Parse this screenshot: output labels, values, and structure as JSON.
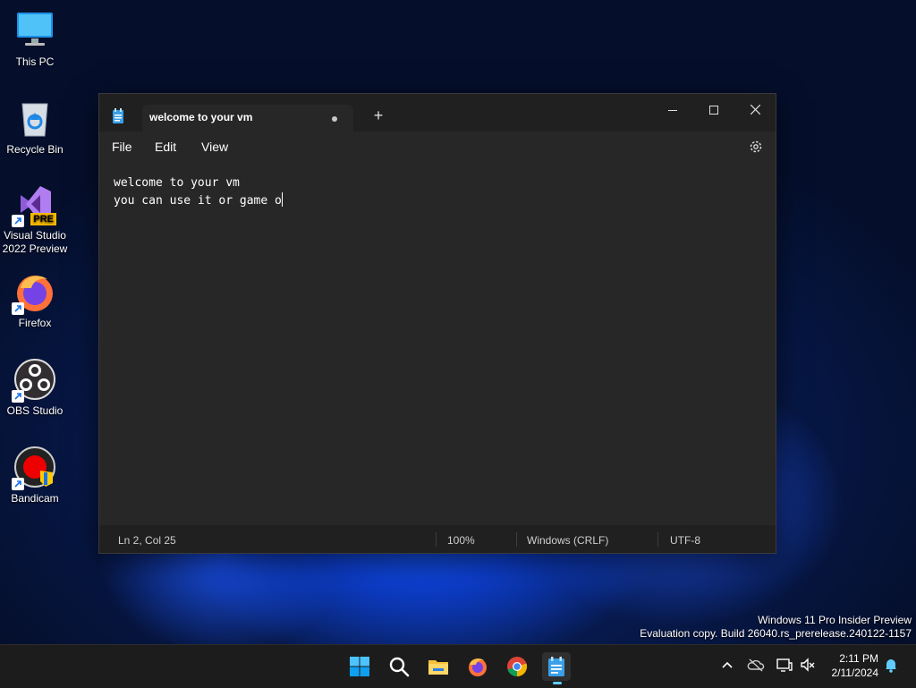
{
  "desktop": {
    "icons": [
      {
        "label": "This PC"
      },
      {
        "label": "Recycle Bin"
      },
      {
        "label": "Visual Studio\n2022 Preview",
        "badge": "PRE"
      },
      {
        "label": "Firefox"
      },
      {
        "label": "OBS Studio"
      },
      {
        "label": "Bandicam"
      }
    ],
    "watermark": {
      "line1": "Windows 11 Pro Insider Preview",
      "line2": "Evaluation copy. Build 26040.rs_prerelease.240122-1157"
    }
  },
  "notepad": {
    "tab_title": "welcome to your vm",
    "new_tab": "+",
    "menu": {
      "file": "File",
      "edit": "Edit",
      "view": "View"
    },
    "content": {
      "line1": "welcome to your vm",
      "line2": "you can use it or game o"
    },
    "status": {
      "position": "Ln 2, Col 25",
      "zoom": "100%",
      "line_ending": "Windows (CRLF)",
      "encoding": "UTF-8"
    }
  },
  "taskbar": {
    "clock": {
      "time": "2:11 PM",
      "date": "2/11/2024"
    },
    "icons": [
      "start-icon",
      "search-icon",
      "file-explorer-icon",
      "firefox-icon",
      "chrome-icon",
      "notepad-icon"
    ]
  },
  "colors": {
    "accent": "#60cdff",
    "window_bg": "#272727",
    "titlebar_bg": "#202020"
  }
}
